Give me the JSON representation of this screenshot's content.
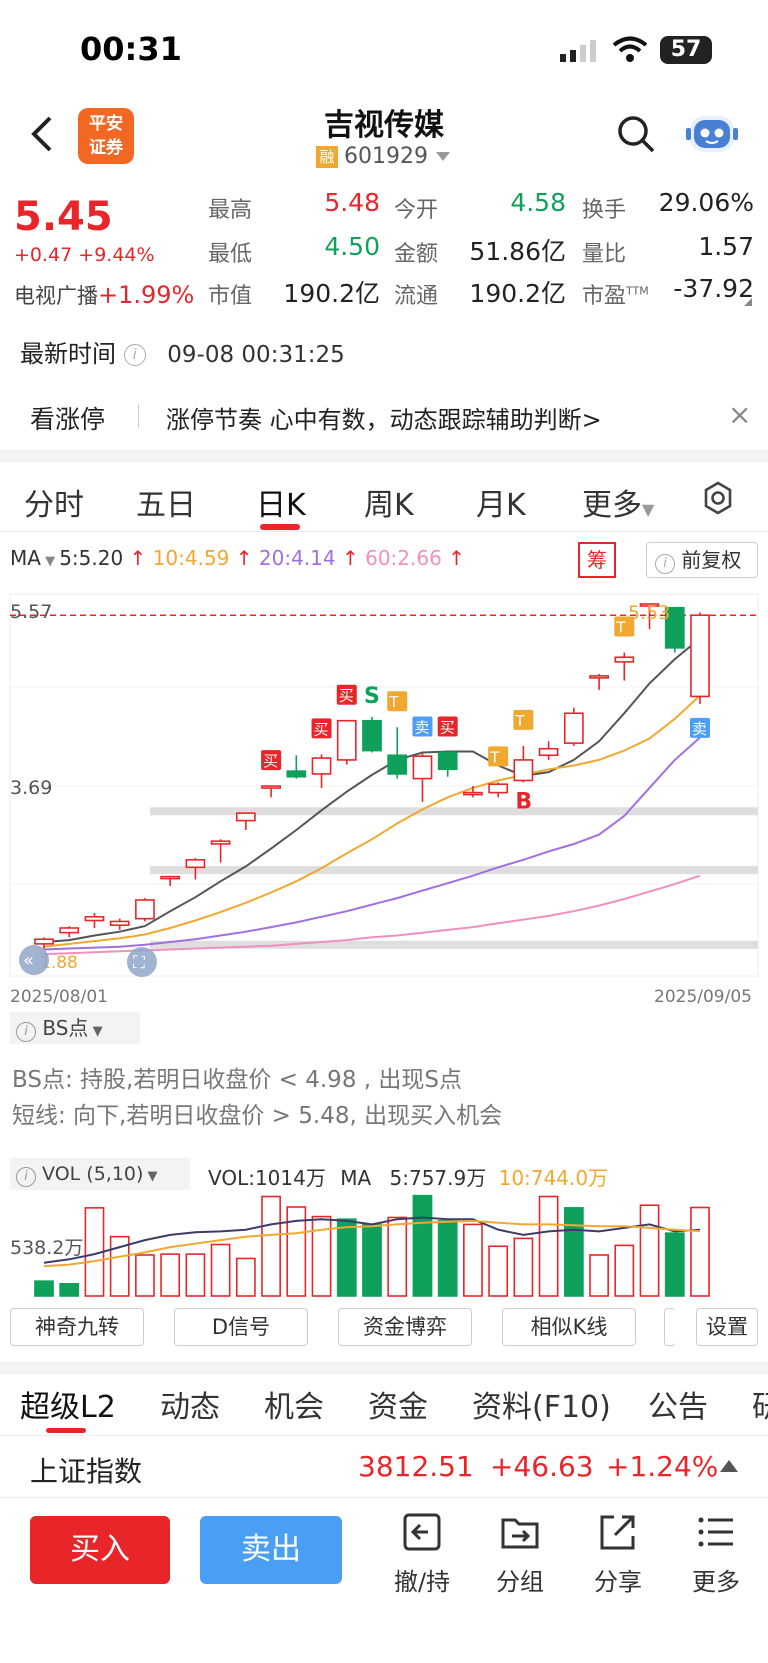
{
  "status_bar": {
    "time": "00:31",
    "battery": "57"
  },
  "header": {
    "logo_line1": "平安",
    "logo_line2": "证券",
    "title": "吉视传媒",
    "margin_badge": "融",
    "code": "601929"
  },
  "quote": {
    "price": "5.45",
    "change": "+0.47",
    "change_pct": "+9.44%",
    "sector_name": "电视广播",
    "sector_pct": "+1.99%",
    "high_label": "最高",
    "high": "5.48",
    "low_label": "最低",
    "low": "4.50",
    "mcap_label": "市值",
    "mcap": "190.2亿",
    "open_label": "今开",
    "open": "4.58",
    "amount_label": "金额",
    "amount": "51.86亿",
    "float_label": "流通",
    "float": "190.2亿",
    "turnover_label": "换手",
    "turnover": "29.06%",
    "vol_ratio_label": "量比",
    "vol_ratio": "1.57",
    "pe_label": "市盈",
    "pe_sup": "TTM",
    "pe": "-37.92"
  },
  "update": {
    "label": "最新时间",
    "time": "09-08 00:31:25"
  },
  "banner": {
    "tag": "看涨停",
    "text": "涨停节奏 心中有数，动态跟踪辅助判断>"
  },
  "chart_tabs": [
    "分时",
    "五日",
    "日K",
    "周K",
    "月K",
    "更多"
  ],
  "ma_legend": {
    "label": "MA",
    "ma5": "5:5.20",
    "ma10": "10:4.59",
    "ma20": "20:4.14",
    "ma60": "60:2.66",
    "chip": "筹",
    "adjust": "前复权"
  },
  "colors": {
    "up": "#e8262a",
    "down": "#0fa15b",
    "ma5": "#555555",
    "ma10": "#f0a830",
    "ma20": "#a070e0",
    "ma60": "#f090c0",
    "accent_blue": "#4a9ff5"
  },
  "chart_data": [
    {
      "type": "candlestick",
      "ylim": [
        1.8,
        5.57
      ],
      "y_ticks": [
        "5.57",
        "3.69"
      ],
      "low_label": "1.88",
      "peak_label": "5.53",
      "start_date": "2025/08/01",
      "end_date": "2025/09/05",
      "candles": [
        {
          "o": 1.93,
          "h": 2.0,
          "l": 1.88,
          "c": 1.98
        },
        {
          "o": 2.05,
          "h": 2.12,
          "l": 2.0,
          "c": 2.1
        },
        {
          "o": 2.18,
          "h": 2.26,
          "l": 2.1,
          "c": 2.22
        },
        {
          "o": 2.13,
          "h": 2.2,
          "l": 2.08,
          "c": 2.17
        },
        {
          "o": 2.2,
          "h": 2.42,
          "l": 2.17,
          "c": 2.4
        },
        {
          "o": 2.65,
          "h": 2.65,
          "l": 2.55,
          "c": 2.65
        },
        {
          "o": 2.75,
          "h": 2.85,
          "l": 2.62,
          "c": 2.83
        },
        {
          "o": 3.0,
          "h": 3.05,
          "l": 2.8,
          "c": 3.03
        },
        {
          "o": 3.25,
          "h": 3.33,
          "l": 3.15,
          "c": 3.33
        },
        {
          "o": 3.62,
          "h": 3.62,
          "l": 3.5,
          "c": 3.62
        },
        {
          "o": 3.78,
          "h": 3.95,
          "l": 3.7,
          "c": 3.72
        },
        {
          "o": 3.75,
          "h": 3.96,
          "l": 3.6,
          "c": 3.92
        },
        {
          "o": 3.9,
          "h": 4.32,
          "l": 3.85,
          "c": 4.32
        },
        {
          "o": 4.32,
          "h": 4.36,
          "l": 3.98,
          "c": 4.0
        },
        {
          "o": 3.95,
          "h": 4.25,
          "l": 3.7,
          "c": 3.75
        },
        {
          "o": 3.7,
          "h": 3.98,
          "l": 3.45,
          "c": 3.94
        },
        {
          "o": 3.98,
          "h": 3.98,
          "l": 3.72,
          "c": 3.8
        },
        {
          "o": 3.55,
          "h": 3.62,
          "l": 3.5,
          "c": 3.55
        },
        {
          "o": 3.55,
          "h": 3.66,
          "l": 3.5,
          "c": 3.64
        },
        {
          "o": 3.68,
          "h": 4.05,
          "l": 3.66,
          "c": 3.9
        },
        {
          "o": 3.95,
          "h": 4.1,
          "l": 3.9,
          "c": 4.02
        },
        {
          "o": 4.08,
          "h": 4.46,
          "l": 4.05,
          "c": 4.4
        },
        {
          "o": 4.8,
          "h": 4.82,
          "l": 4.65,
          "c": 4.8
        },
        {
          "o": 4.95,
          "h": 5.05,
          "l": 4.75,
          "c": 5.0
        },
        {
          "o": 5.57,
          "h": 5.57,
          "l": 5.3,
          "c": 5.57
        },
        {
          "o": 5.53,
          "h": 5.53,
          "l": 5.05,
          "c": 5.1
        },
        {
          "o": 4.58,
          "h": 5.48,
          "l": 4.5,
          "c": 5.45
        }
      ],
      "ma": {
        "MA5": [
          1.95,
          1.97,
          2.02,
          2.06,
          2.12,
          2.28,
          2.43,
          2.6,
          2.76,
          2.95,
          3.15,
          3.36,
          3.56,
          3.74,
          3.9,
          3.98,
          3.99,
          3.99,
          3.84,
          3.73,
          3.77,
          3.9,
          4.1,
          4.4,
          4.72,
          4.98,
          5.2
        ],
        "MA10": [
          1.9,
          1.93,
          1.96,
          1.99,
          2.03,
          2.1,
          2.18,
          2.27,
          2.37,
          2.48,
          2.6,
          2.74,
          2.9,
          3.05,
          3.22,
          3.37,
          3.5,
          3.6,
          3.68,
          3.74,
          3.8,
          3.84,
          3.9,
          4.0,
          4.13,
          4.34,
          4.59
        ],
        "MA20": [
          1.87,
          1.88,
          1.89,
          1.9,
          1.92,
          1.95,
          1.98,
          2.02,
          2.06,
          2.11,
          2.16,
          2.22,
          2.28,
          2.35,
          2.42,
          2.5,
          2.58,
          2.66,
          2.75,
          2.83,
          2.92,
          3.0,
          3.1,
          3.3,
          3.6,
          3.9,
          4.14
        ],
        "MA60": [
          1.82,
          1.83,
          1.84,
          1.85,
          1.86,
          1.87,
          1.88,
          1.89,
          1.9,
          1.91,
          1.93,
          1.95,
          1.97,
          2.0,
          2.02,
          2.05,
          2.08,
          2.11,
          2.15,
          2.19,
          2.23,
          2.28,
          2.34,
          2.41,
          2.49,
          2.57,
          2.66
        ]
      },
      "signals": [
        {
          "i": 9,
          "text": "买",
          "kind": "buy"
        },
        {
          "i": 11,
          "text": "买",
          "kind": "buy"
        },
        {
          "i": 12,
          "text": "买",
          "kind": "buy"
        },
        {
          "i": 13,
          "text": "S",
          "kind": "S"
        },
        {
          "i": 14,
          "text": "T",
          "kind": "T"
        },
        {
          "i": 15,
          "text": "卖",
          "kind": "sell"
        },
        {
          "i": 16,
          "text": "买",
          "kind": "buy"
        },
        {
          "i": 18,
          "text": "T",
          "kind": "T"
        },
        {
          "i": 19,
          "text": "B",
          "kind": "B"
        },
        {
          "i": 19,
          "text": "T",
          "kind": "T"
        },
        {
          "i": 23,
          "text": "T",
          "kind": "T"
        },
        {
          "i": 26,
          "text": "卖",
          "kind": "sell"
        }
      ],
      "support_levels": [
        3.35,
        2.72,
        1.92
      ]
    },
    {
      "type": "bar",
      "title": "VOL (5,10)",
      "readout": "VOL:1014万",
      "ma_label": "MA",
      "ma5_label": "5:757.9万",
      "ma10_label": "10:744.0万",
      "ref_label": "538.2万",
      "ylim": [
        0,
        1100
      ],
      "values": [
        170,
        140,
        1010,
        680,
        470,
        480,
        480,
        590,
        430,
        1140,
        1020,
        910,
        880,
        820,
        900,
        1150,
        860,
        820,
        570,
        660,
        1140,
        1010,
        470,
        580,
        1040,
        720,
        1014
      ],
      "up": [
        false,
        false,
        true,
        true,
        true,
        true,
        true,
        true,
        true,
        true,
        true,
        true,
        false,
        false,
        true,
        false,
        false,
        true,
        true,
        true,
        true,
        false,
        true,
        true,
        true,
        false,
        true
      ],
      "ma5": [
        380,
        420,
        480,
        560,
        640,
        700,
        730,
        740,
        760,
        820,
        860,
        880,
        860,
        820,
        880,
        900,
        880,
        880,
        760,
        700,
        740,
        760,
        740,
        780,
        820,
        740,
        760
      ],
      "ma10": [
        340,
        360,
        400,
        450,
        500,
        560,
        600,
        640,
        680,
        700,
        720,
        760,
        790,
        800,
        820,
        840,
        850,
        860,
        840,
        820,
        820,
        810,
        800,
        800,
        780,
        760,
        744
      ]
    }
  ],
  "bs_panel": {
    "label": "BS点",
    "line1": "BS点: 持股,若明日收盘价 < 4.98 , 出现S点",
    "line2": "短线: 向下,若明日收盘价 > 5.48, 出现买入机会"
  },
  "indicator_buttons": [
    "神奇九转",
    "D信号",
    "资金博弈",
    "相似K线",
    "设置"
  ],
  "bottom_tabs": [
    "超级L2",
    "动态",
    "机会",
    "资金",
    "资料(F10)",
    "公告",
    "研"
  ],
  "index_bar": {
    "name": "上证指数",
    "value": "3812.51",
    "change": "+46.63",
    "pct": "+1.24%"
  },
  "toolbar": {
    "buy": "买入",
    "sell": "卖出",
    "revoke": "撤/持",
    "group": "分组",
    "share": "分享",
    "more": "更多"
  }
}
